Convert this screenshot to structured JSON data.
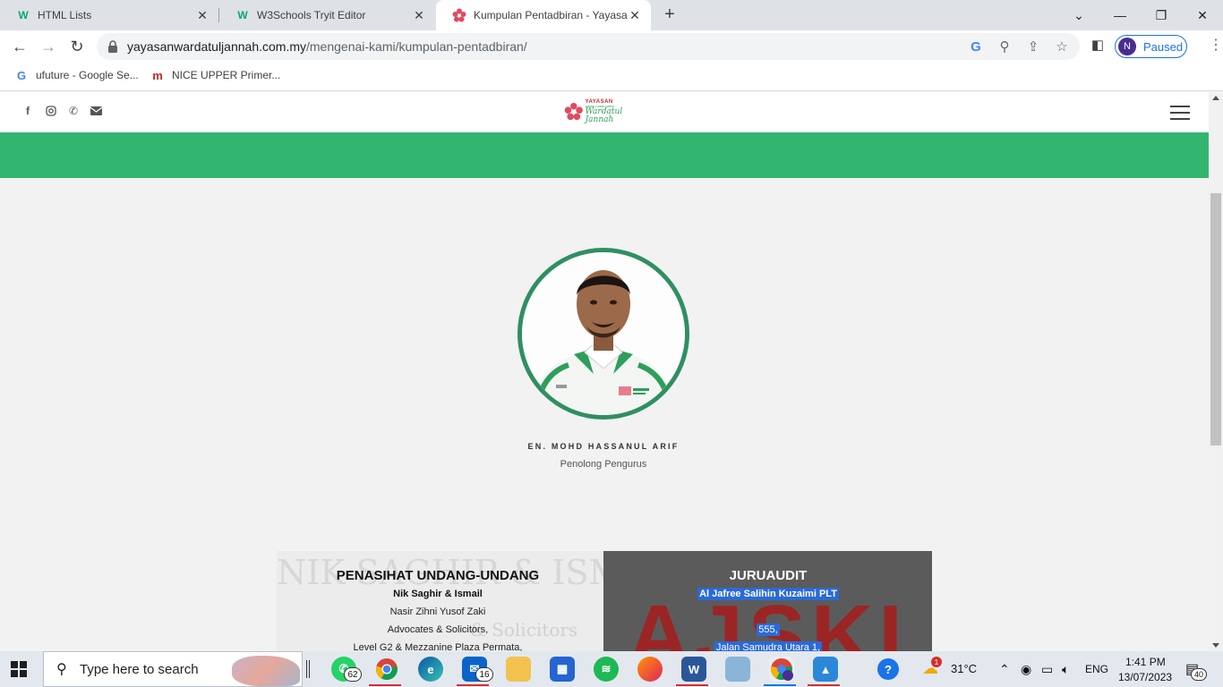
{
  "browser": {
    "tabs": [
      {
        "favicon": "w3schools-icon",
        "title": "HTML Lists",
        "active": false
      },
      {
        "favicon": "w3schools-icon",
        "title": "W3Schools Tryit Editor",
        "active": false
      },
      {
        "favicon": "yayasan-flower-icon",
        "title": "Kumpulan Pentadbiran - Yayasan",
        "active": true
      }
    ],
    "url_domain": "yayasanwardatuljannah.com.my",
    "url_path": "/mengenai-kami/kumpulan-pentadbiran/",
    "profile_initial": "N",
    "profile_status": "Paused",
    "bookmarks": [
      {
        "icon": "google-icon",
        "label": "ufuture - Google Se..."
      },
      {
        "icon": "nice-m-icon",
        "label": "NICE UPPER Primer..."
      }
    ]
  },
  "site": {
    "logo_line1": "YAYASAN",
    "logo_line2": "sayap untuk yatim",
    "logo_line3": "Wardatul Jannah",
    "social_icons": [
      "facebook-icon",
      "instagram-icon",
      "phone-icon",
      "email-icon"
    ],
    "green": "#32b56f",
    "member": {
      "name": "EN. MOHD HASSANUL ARIF",
      "role": "Penolong Pengurus"
    },
    "card_left": {
      "title": "PENASIHAT UNDANG-UNDANG",
      "firm": "Nik Saghir & Ismail",
      "lines": [
        "Nasir Zihni Yusof Zaki",
        "Advocates & Solicitors,",
        "Level G2 & Mezzanine Plaza Permata,"
      ],
      "bg_text_1": "NIK SAGHIR & ISMAIL",
      "bg_text_2": "& Solicitors"
    },
    "card_right": {
      "title": "JURUAUDIT",
      "firm": "Al Jafree Salihin Kuzaimi PLT",
      "lines": [
        "555,",
        "Jalan Samudra Utara 1,"
      ],
      "bg_text": "AJSKI"
    }
  },
  "taskbar": {
    "search_placeholder": "Type here to search",
    "whatsapp_badge": "62",
    "mail_badge": "16",
    "weather_temp": "31°C",
    "language": "ENG",
    "time": "1:41 PM",
    "date": "13/07/2023",
    "notification_count": "40",
    "weather_alert": "1"
  }
}
